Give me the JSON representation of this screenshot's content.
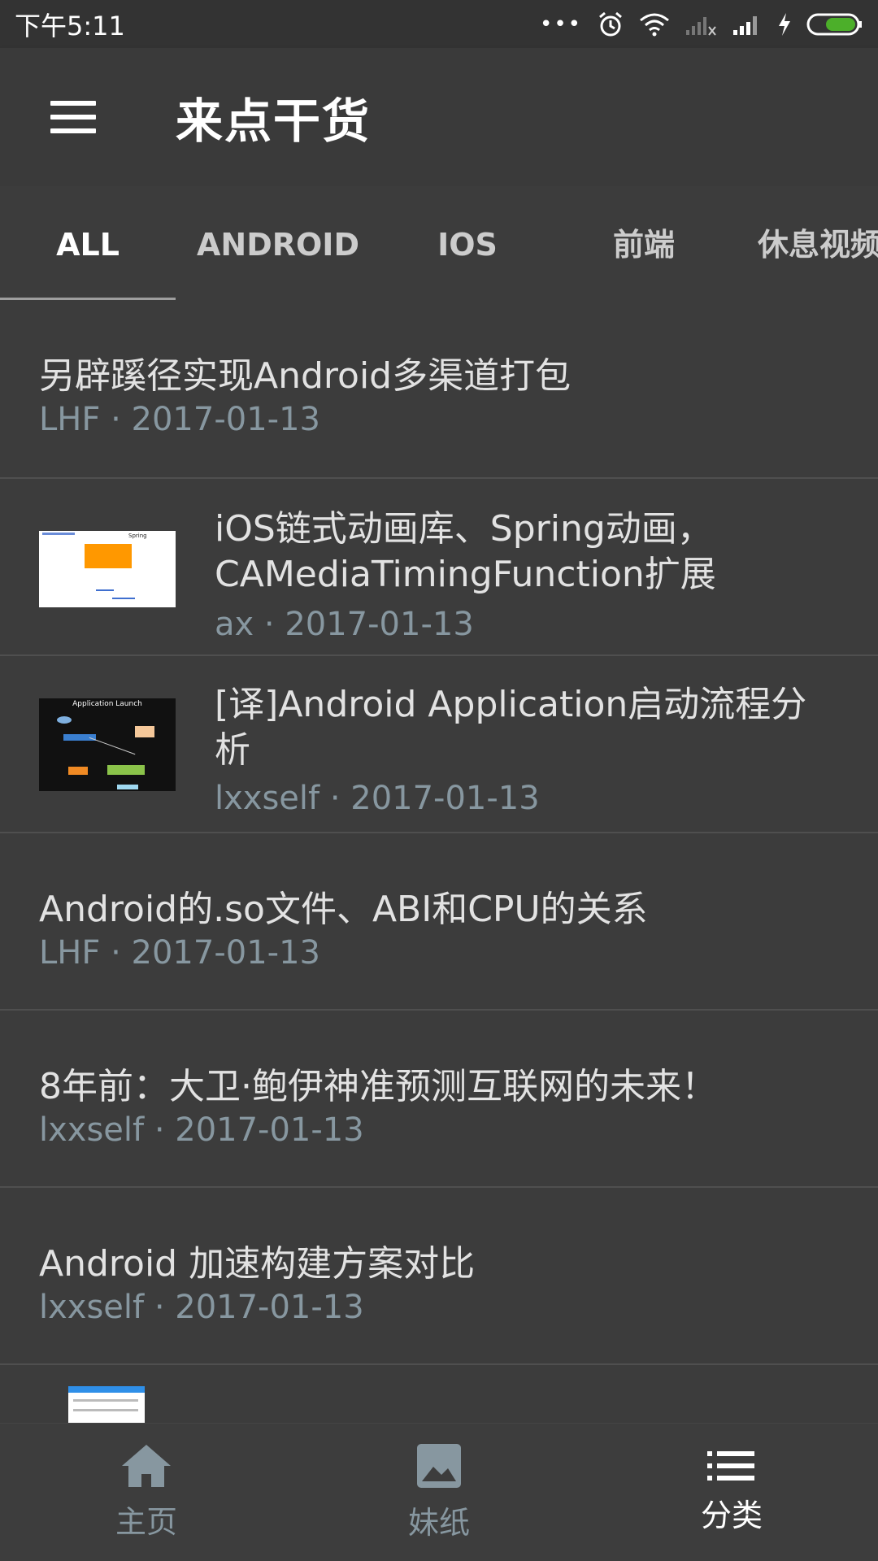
{
  "status": {
    "time": "下午5:11",
    "dots": "•••",
    "battery_color": "#4caf2a"
  },
  "appbar": {
    "title": "来点干货"
  },
  "tabs": [
    {
      "label": "ALL",
      "active": true
    },
    {
      "label": "ANDROID"
    },
    {
      "label": "IOS"
    },
    {
      "label": "前端"
    },
    {
      "label": "休息视频"
    }
  ],
  "articles": [
    {
      "title_line1": "另辟蹊径实现Android多渠道打包",
      "meta": "LHF · 2017-01-13",
      "thumbnail": false
    },
    {
      "title_line1": "iOS链式动画库、Spring动画，",
      "title_line2": "CAMediaTimingFunction扩展",
      "meta": "ax · 2017-01-13",
      "thumbnail": true,
      "thumbnail_caption": "Spring"
    },
    {
      "title_line1": "[译]Android Application启动流程分",
      "title_line2": "析",
      "meta": "lxxself · 2017-01-13",
      "thumbnail": true,
      "thumbnail_caption": "Application Launch"
    },
    {
      "title_line1": "Android的.so文件、ABI和CPU的关系",
      "meta": "LHF · 2017-01-13",
      "thumbnail": false
    },
    {
      "title_line1": "8年前：大卫·鲍伊神准预测互联网的未来！",
      "meta": "lxxself · 2017-01-13",
      "thumbnail": false
    },
    {
      "title_line1": "Android 加速构建方案对比",
      "meta": "lxxself · 2017-01-13",
      "thumbnail": false
    }
  ],
  "bottomnav": [
    {
      "label": "主页",
      "icon": "home-icon"
    },
    {
      "label": "妹纸",
      "icon": "image-icon"
    },
    {
      "label": "分类",
      "icon": "list-icon",
      "active": true
    }
  ]
}
